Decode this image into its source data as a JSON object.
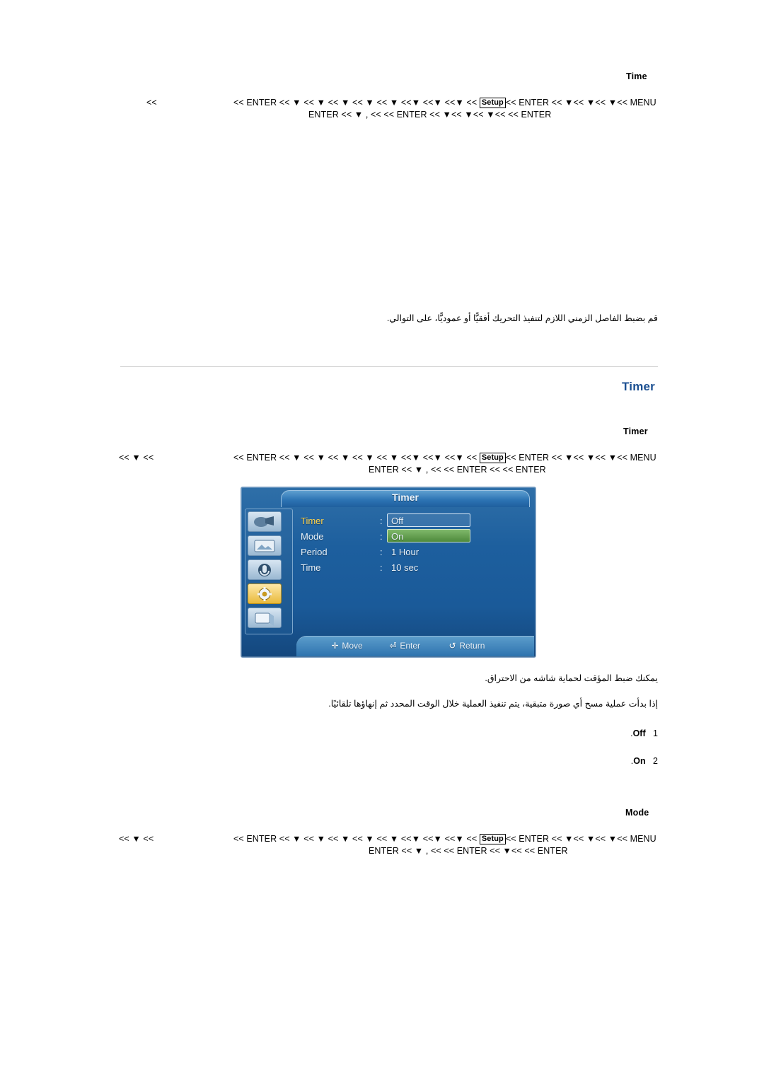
{
  "section_time": {
    "label": "Time",
    "nav_left": "<<",
    "nav_line1_a": "<< ENTER << ▼ << ▼ << ▼ << ▼ << ▼ <<▼ <<▼ <<▼ << ",
    "nav_setup": "Setup",
    "nav_line1_b": "<< ENTER << ▼<< ▼<< ▼<< MENU",
    "nav_line2": "ENTER << ▼ ,    <<         << ENTER << ▼<< ▼<< ▼<<              << ENTER",
    "arabic_caption": "قم بضبط الفاصل الزمني اللازم لتنفيذ التحريك أفقيًّا أو عموديًّا، على التوالي."
  },
  "section_timer": {
    "title": "Timer",
    "label": "Timer",
    "nav_left": "<< ▼ <<",
    "nav_line1_a": "<< ENTER << ▼ << ▼ << ▼ << ▼ << ▼ <<▼ <<▼ <<▼ << ",
    "nav_setup": "Setup",
    "nav_line1_b": "<< ENTER << ▼<< ▼<< ▼<< MENU",
    "nav_line2": "ENTER << ▼ ,    <<          << ENTER <<            << ENTER",
    "arabic_caption_1": "يمكنك ضبط المؤقت لحماية شاشه من الاحتراق.",
    "arabic_caption_2": "إذا بدأت عملية مسح أي صورة متبقية، يتم تنفيذ العملية خلال الوقت المحدد ثم إنهاؤها تلقائيًا.",
    "list": [
      {
        "num": "1.",
        "label": "Off"
      },
      {
        "num": "2.",
        "label": "On"
      }
    ]
  },
  "section_mode": {
    "label": "Mode",
    "nav_left": "<< ▼ <<",
    "nav_line1_a": "<< ENTER << ▼ << ▼ << ▼ << ▼ << ▼ <<▼ <<▼ <<▼ << ",
    "nav_setup": "Setup",
    "nav_line1_b": "<< ENTER << ▼<< ▼<< ▼<< MENU",
    "nav_line2": "ENTER << ▼ ,    <<          << ENTER << ▼<<            << ENTER"
  },
  "osd": {
    "title": "Timer",
    "rows": [
      {
        "label": "Timer",
        "colon": ":",
        "value": "Off"
      },
      {
        "label": "Mode",
        "colon": ":",
        "value": "On"
      },
      {
        "label": "Period",
        "colon": ":",
        "value": "1 Hour"
      },
      {
        "label": "Time",
        "colon": ":",
        "value": "10 sec"
      }
    ],
    "footer": [
      {
        "icon": "move-icon",
        "label": "Move"
      },
      {
        "icon": "enter-icon",
        "label": "Enter"
      },
      {
        "icon": "return-icon",
        "label": "Return"
      }
    ]
  }
}
